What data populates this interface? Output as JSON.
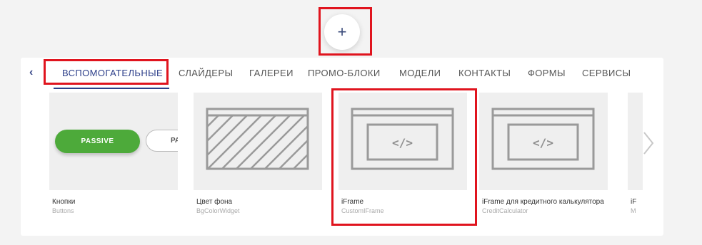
{
  "add_button": {
    "symbol": "+"
  },
  "tabs": [
    {
      "label": "ВСПОМОГАТЕЛЬНЫЕ",
      "active": true
    },
    {
      "label": "СЛАЙДЕРЫ"
    },
    {
      "label": "ГАЛЕРЕИ"
    },
    {
      "label": "ПРОМО-БЛОКИ"
    },
    {
      "label": "МОДЕЛИ"
    },
    {
      "label": "КОНТАКТЫ"
    },
    {
      "label": "ФОРМЫ"
    },
    {
      "label": "СЕРВИСЫ"
    }
  ],
  "back_icon": "‹",
  "widgets": [
    {
      "title": "Кнопки",
      "subtitle": "Buttons",
      "preview": {
        "primary": "PASSIVE",
        "secondary": "PA"
      }
    },
    {
      "title": "Цвет фона",
      "subtitle": "BgColorWidget"
    },
    {
      "title": "iFrame",
      "subtitle": "CustomIFrame",
      "code_glyph": "</>"
    },
    {
      "title": "iFrame для кредитного калькулятора",
      "subtitle": "CreditCalculator",
      "code_glyph": "</>"
    },
    {
      "title": "iF",
      "subtitle": "M"
    }
  ],
  "colors": {
    "accent": "#2d3f8a",
    "highlight": "#e0141e",
    "button_green": "#4daa3a"
  },
  "icons": {
    "next": "chevron-right-icon",
    "add": "plus-icon"
  }
}
